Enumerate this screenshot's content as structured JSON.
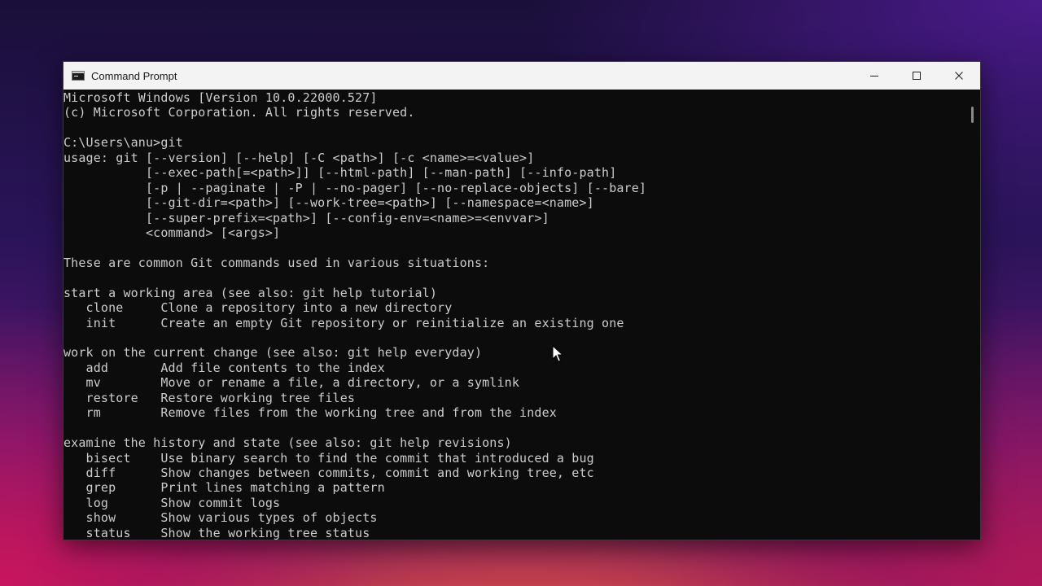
{
  "window": {
    "title": "Command Prompt",
    "controls": {
      "minimize": "minimize",
      "maximize": "maximize",
      "close": "close"
    }
  },
  "console": {
    "lines": [
      "Microsoft Windows [Version 10.0.22000.527]",
      "(c) Microsoft Corporation. All rights reserved.",
      "",
      "C:\\Users\\anu>git",
      "usage: git [--version] [--help] [-C <path>] [-c <name>=<value>]",
      "           [--exec-path[=<path>]] [--html-path] [--man-path] [--info-path]",
      "           [-p | --paginate | -P | --no-pager] [--no-replace-objects] [--bare]",
      "           [--git-dir=<path>] [--work-tree=<path>] [--namespace=<name>]",
      "           [--super-prefix=<path>] [--config-env=<name>=<envvar>]",
      "           <command> [<args>]",
      "",
      "These are common Git commands used in various situations:",
      "",
      "start a working area (see also: git help tutorial)",
      "   clone     Clone a repository into a new directory",
      "   init      Create an empty Git repository or reinitialize an existing one",
      "",
      "work on the current change (see also: git help everyday)",
      "   add       Add file contents to the index",
      "   mv        Move or rename a file, a directory, or a symlink",
      "   restore   Restore working tree files",
      "   rm        Remove files from the working tree and from the index",
      "",
      "examine the history and state (see also: git help revisions)",
      "   bisect    Use binary search to find the commit that introduced a bug",
      "   diff      Show changes between commits, commit and working tree, etc",
      "   grep      Print lines matching a pattern",
      "   log       Show commit logs",
      "   show      Show various types of objects",
      "   status    Show the working tree status"
    ]
  },
  "colors": {
    "console_bg": "#0c0c0c",
    "console_text": "#cccccc",
    "titlebar_bg": "#f3f3f3"
  }
}
